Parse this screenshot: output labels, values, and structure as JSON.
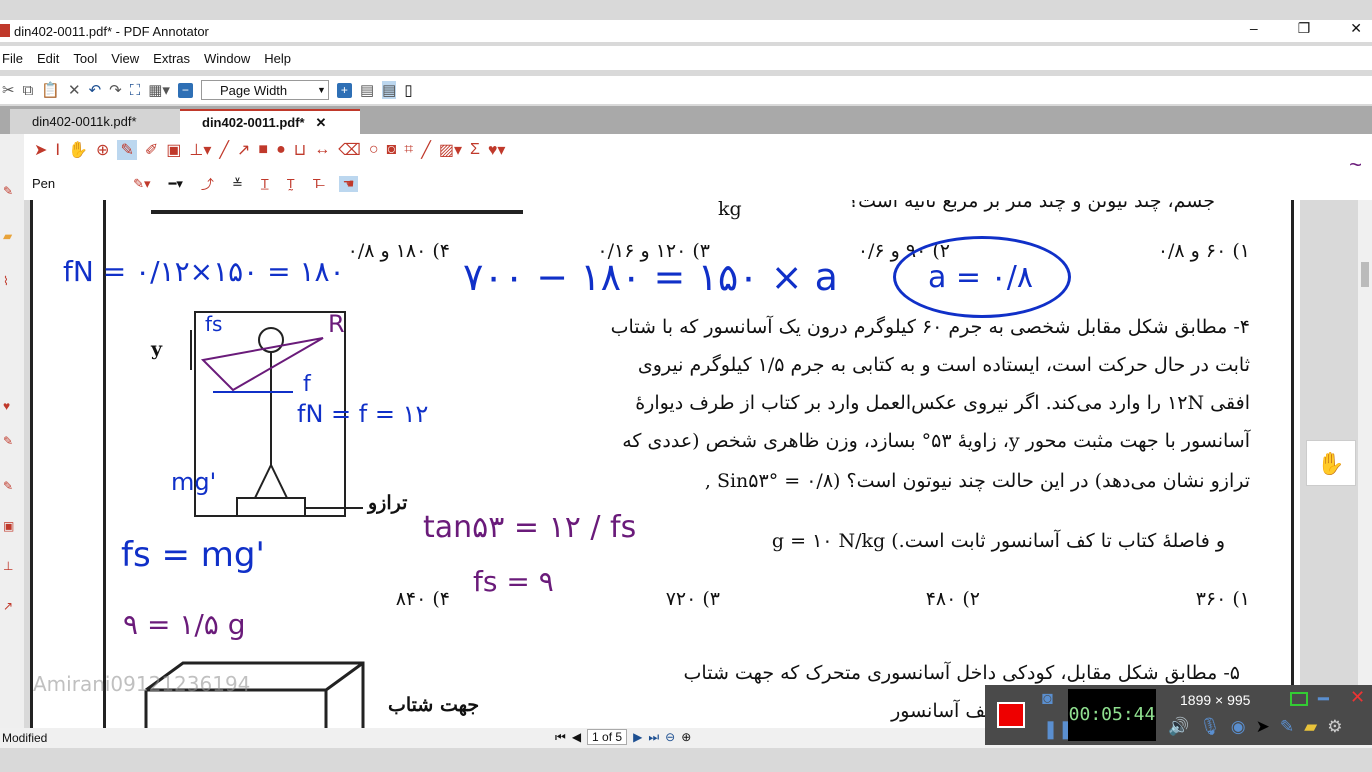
{
  "window": {
    "title": "din402-0011.pdf* - PDF Annotator",
    "controls": [
      "–",
      "❐",
      "✕"
    ]
  },
  "menu": [
    "File",
    "Edit",
    "Tool",
    "View",
    "Extras",
    "Window",
    "Help"
  ],
  "toolbar": {
    "zoom_mode": "Page Width"
  },
  "tabs": [
    {
      "label": "din402-0011k.pdf*",
      "active": false
    },
    {
      "label": "din402-0011.pdf*",
      "active": true,
      "close": "✕"
    }
  ],
  "annotation_toolbar": {
    "active_tool": "Pen",
    "accent": "#c0392b"
  },
  "document": {
    "top_line": "جسم، چند نیوتن و چند متر بر مربع ثانیه است؟",
    "unit_kg": "kg",
    "prev_options": [
      "۱) ۶۰ و ۰/۸",
      "۲) ۹۰ و ۰/۶",
      "۳) ۱۲۰ و ۰/۱۶",
      "۴) ۱۸۰ و ۰/۸"
    ],
    "q4_lines": [
      "۴- مطابق شکل مقابل شخصی به جرم ۶۰ کیلوگرم درون یک آسانسور که با شتاب",
      "ثابت در حال حرکت است، ایستاده است و به کتابی به جرم ۱/۵ کیلوگرم نیروی",
      "افقی ۱۲N را وارد می‌کند. اگر نیروی عکس‌العمل وارد بر کتاب از طرف دیوارهٔ",
      "آسانسور با جهت مثبت محور y، زاویهٔ ۵۳° بسازد، وزن ظاهری شخص (عددی که",
      "ترازو نشان می‌دهد) در این حالت چند نیوتون است؟ (Sin۵۳° = ۰/۸ ,",
      "و فاصلهٔ کتاب تا کف آسانسور ثابت است.) g = ۱۰ N/kg"
    ],
    "q4_options": [
      "۱) ۳۶۰",
      "۲) ۴۸۰",
      "۳) ۷۲۰",
      "۴) ۸۴۰"
    ],
    "figure_labels": {
      "axis": "y",
      "scale": "ترازو",
      "accel": "جهت شتاب"
    },
    "q5_lines": [
      "۵- مطابق شکل مقابل، کودکی داخل آسانسوری متحرک که جهت شتاب",
      "... است. اگر بزرگی نیرویی که کف آسانسور"
    ],
    "watermark": "@Amirani09121236194"
  },
  "handwriting": {
    "fn_calc": "fN = ۰/۱۲×۱۵۰ = ۱۸۰",
    "main_eq": "۷۰۰ − ۱۸۰ = ۱۵۰ × a",
    "result": "a = ۰/۸",
    "fs": "fs",
    "r": "R",
    "f": "f",
    "fn_eq": "fN = f = ۱۲",
    "mg": "mg'",
    "tan": "tan۵۳ = ۱۲ / fs",
    "fs_val": "fs = ۹",
    "fs_mg": "fs = mg'",
    "g_eq": "۹ = ۱/۵ g"
  },
  "status": {
    "left": "Modified",
    "page": "1 of 5"
  },
  "recorder": {
    "time": "00:05:44",
    "resolution": "1899 × 995"
  }
}
